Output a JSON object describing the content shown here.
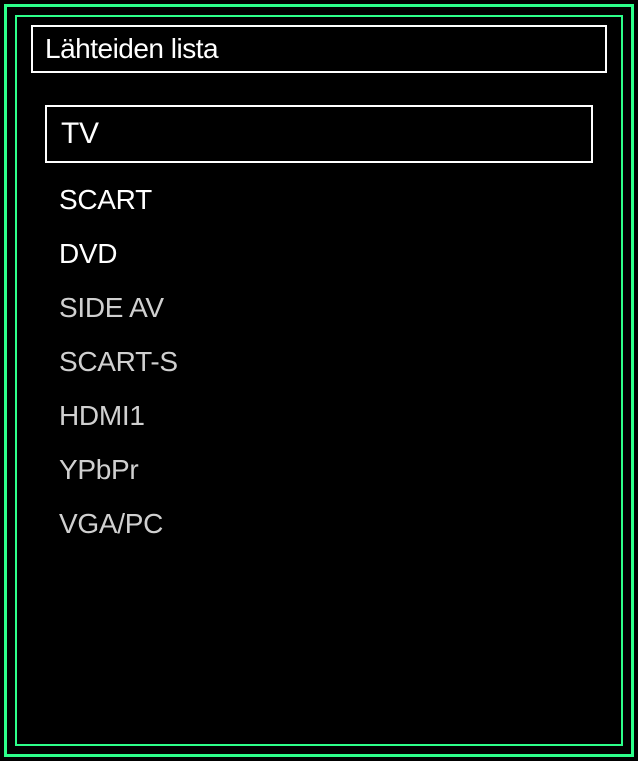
{
  "menu": {
    "title": "Lähteiden lista",
    "items": [
      {
        "label": "TV",
        "selected": true,
        "bright": true
      },
      {
        "label": "SCART",
        "selected": false,
        "bright": true
      },
      {
        "label": "DVD",
        "selected": false,
        "bright": true
      },
      {
        "label": "SIDE AV",
        "selected": false,
        "bright": false
      },
      {
        "label": "SCART-S",
        "selected": false,
        "bright": false
      },
      {
        "label": "HDMI1",
        "selected": false,
        "bright": false
      },
      {
        "label": "YPbPr",
        "selected": false,
        "bright": false
      },
      {
        "label": "VGA/PC",
        "selected": false,
        "bright": false
      }
    ]
  }
}
